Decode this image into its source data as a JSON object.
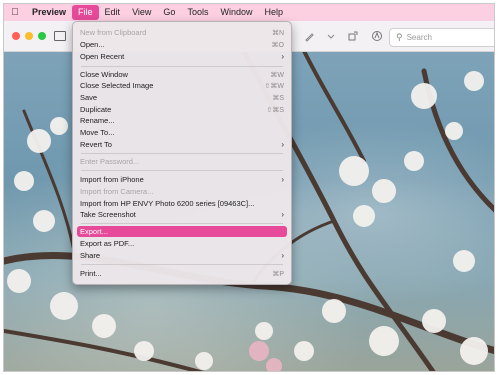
{
  "menubar": {
    "apple_icon": "apple-logo",
    "items": [
      "Preview",
      "File",
      "Edit",
      "View",
      "Go",
      "Tools",
      "Window",
      "Help"
    ],
    "active": "File"
  },
  "toolbar": {
    "search_placeholder": "Search"
  },
  "file_menu": {
    "items": [
      {
        "label": "New from Clipboard",
        "shortcut": "⌘N",
        "disabled": true
      },
      {
        "label": "Open...",
        "shortcut": "⌘O"
      },
      {
        "label": "Open Recent",
        "submenu": true
      },
      {
        "separator": true
      },
      {
        "label": "Close Window",
        "shortcut": "⌘W"
      },
      {
        "label": "Close Selected Image",
        "shortcut": "⇧⌘W"
      },
      {
        "label": "Save",
        "shortcut": "⌘S"
      },
      {
        "label": "Duplicate",
        "shortcut": "⇧⌘S"
      },
      {
        "label": "Rename..."
      },
      {
        "label": "Move To..."
      },
      {
        "label": "Revert To",
        "submenu": true
      },
      {
        "separator": true
      },
      {
        "label": "Enter Password...",
        "disabled": true
      },
      {
        "separator": true
      },
      {
        "label": "Import from iPhone",
        "submenu": true
      },
      {
        "label": "Import from Camera...",
        "disabled": true
      },
      {
        "label": "Import from HP ENVY Photo 6200 series [09463C]..."
      },
      {
        "label": "Take Screenshot",
        "submenu": true
      },
      {
        "separator": true
      },
      {
        "label": "Export...",
        "selected": true
      },
      {
        "label": "Export as PDF..."
      },
      {
        "label": "Share",
        "submenu": true
      },
      {
        "separator": true
      },
      {
        "label": "Print...",
        "shortcut": "⌘P"
      }
    ]
  },
  "colors": {
    "accent": "#e64a99",
    "menubar_bg": "#fcd0e1"
  }
}
